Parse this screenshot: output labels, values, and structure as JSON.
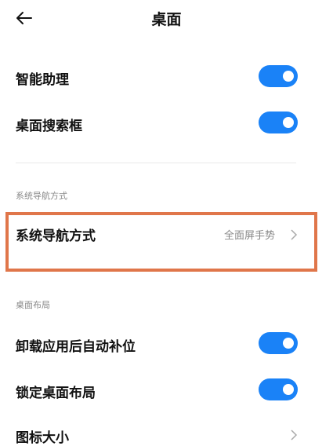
{
  "header": {
    "title": "桌面",
    "back_icon": "back-arrow-icon"
  },
  "settings": {
    "assistant": {
      "label": "智能助理",
      "enabled": true
    },
    "search_box": {
      "label": "桌面搜索框",
      "enabled": true
    }
  },
  "navigation_section": {
    "section_title": "系统导航方式",
    "item": {
      "label": "系统导航方式",
      "value": "全面屏手势"
    },
    "highlight_color": "#e0764a"
  },
  "layout_section": {
    "section_title": "桌面布局",
    "auto_fill": {
      "label": "卸载应用后自动补位",
      "enabled": true
    },
    "lock_layout": {
      "label": "锁定桌面布局",
      "enabled": true
    },
    "icon_size": {
      "label": "图标大小"
    }
  },
  "colors": {
    "toggle_on": "#1a82f7",
    "text_secondary": "#888888"
  }
}
